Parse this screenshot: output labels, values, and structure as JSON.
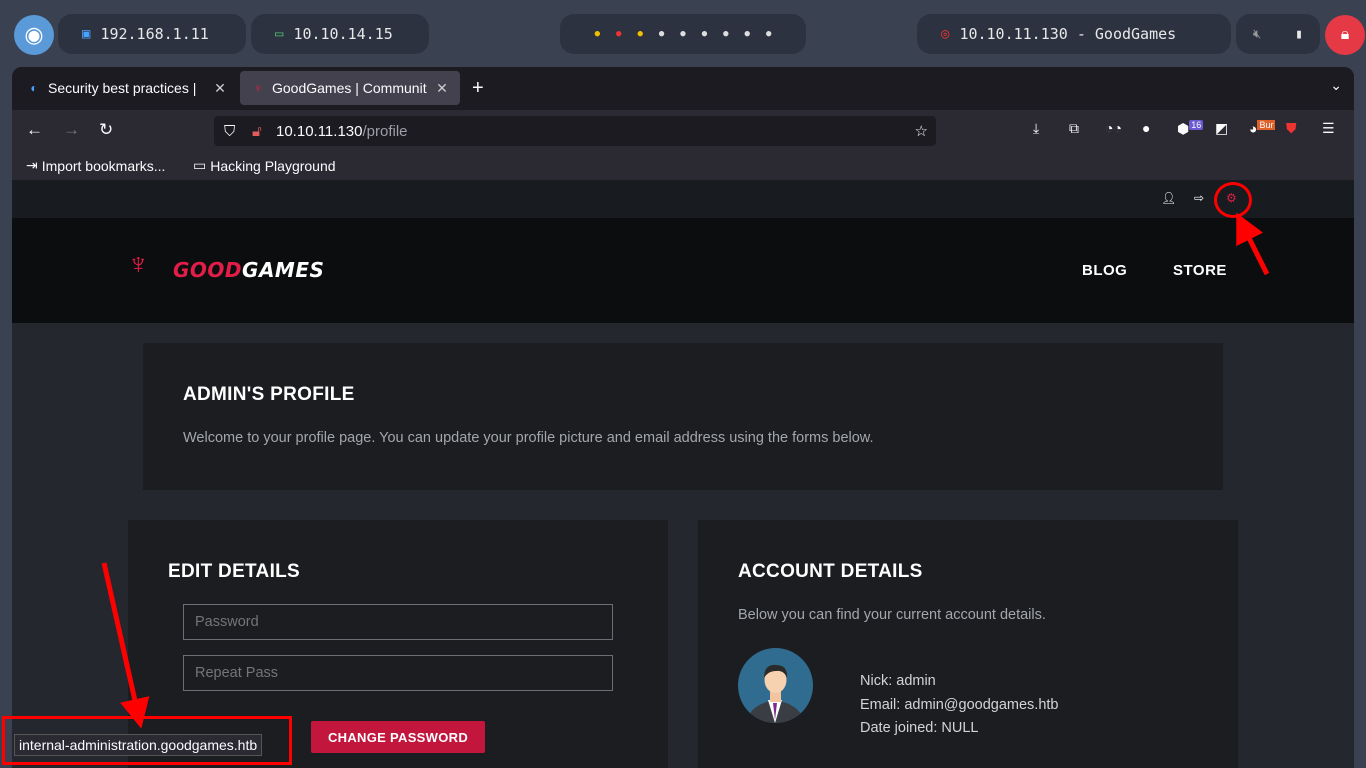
{
  "taskbar": {
    "ip_local": "192.168.1.11",
    "ip_vpn": "10.10.14.15",
    "target": "10.10.11.130 - GoodGames"
  },
  "browser": {
    "tabs": [
      {
        "title": "Security best practices |",
        "active": false
      },
      {
        "title": "GoodGames | Communit",
        "active": true
      }
    ],
    "url_host": "10.10.11.130",
    "url_path": "/profile",
    "extension_badges": {
      "count": "16",
      "burp": "Bur"
    },
    "bookmarks": [
      {
        "label": "Import bookmarks..."
      },
      {
        "label": "Hacking Playground"
      }
    ],
    "status_url": "internal-administration.goodgames.htb"
  },
  "site": {
    "brand_part1": "GOOD",
    "brand_part2": "GAMES",
    "nav": [
      {
        "label": "BLOG"
      },
      {
        "label": "STORE"
      }
    ],
    "profile": {
      "title": "ADMIN'S PROFILE",
      "welcome": "Welcome to your profile page. You can update your profile picture and email address using the forms below."
    },
    "edit": {
      "title": "EDIT DETAILS",
      "password_placeholder": "Password",
      "repeat_placeholder": "Repeat Pass",
      "button": "CHANGE PASSWORD"
    },
    "account": {
      "title": "ACCOUNT DETAILS",
      "subtitle": "Below you can find your current account details.",
      "nick": "Nick: admin",
      "email": "Email: admin@goodgames.htb",
      "joined": "Date joined: NULL"
    }
  },
  "colors": {
    "accent": "#c2163d",
    "annotation": "#ff0000"
  },
  "icons": {
    "user": "user-icon",
    "logout": "logout-icon",
    "settings": "gear-icon"
  }
}
